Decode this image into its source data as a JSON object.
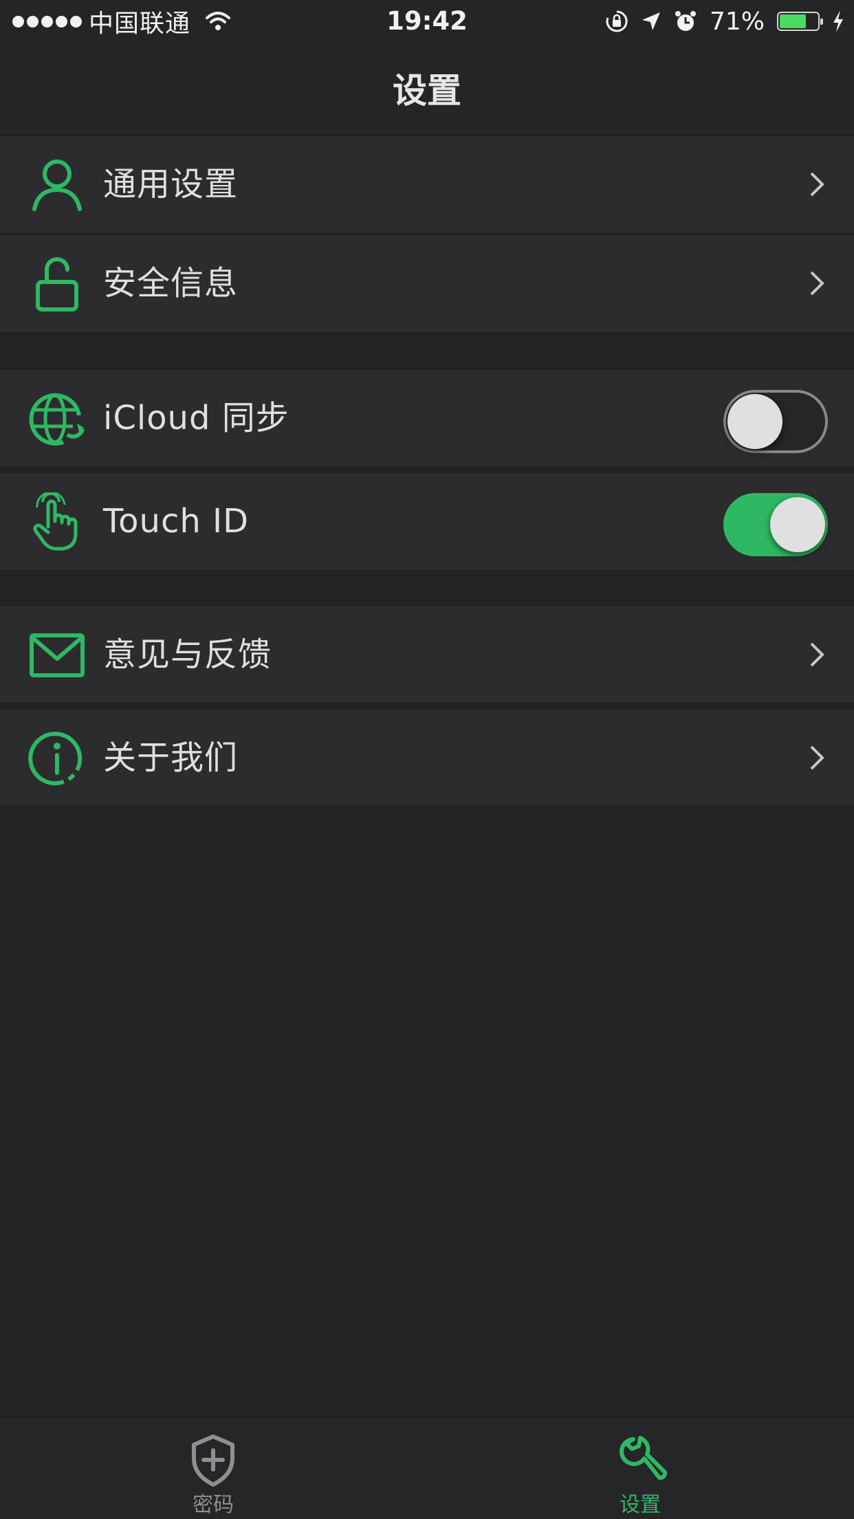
{
  "status_bar": {
    "carrier": "中国联通",
    "time": "19:42",
    "battery_percent": "71%",
    "battery_level": 0.71,
    "icons": [
      "signal-dots",
      "wifi-icon",
      "rotation-lock-icon",
      "location-arrow-icon",
      "alarm-icon",
      "battery-icon",
      "charging-bolt-icon"
    ]
  },
  "nav": {
    "title": "设置"
  },
  "settings": {
    "general": {
      "label": "通用设置",
      "icon": "person-icon"
    },
    "security": {
      "label": "安全信息",
      "icon": "unlock-icon"
    },
    "icloud_sync": {
      "label": "iCloud 同步",
      "icon": "globe-sync-icon",
      "enabled": false
    },
    "touch_id": {
      "label": "Touch ID",
      "icon": "fingerprint-hand-icon",
      "enabled": true
    },
    "feedback": {
      "label": "意见与反馈",
      "icon": "mail-icon"
    },
    "about": {
      "label": "关于我们",
      "icon": "info-icon"
    }
  },
  "tab_bar": {
    "tabs": [
      {
        "label": "密码",
        "icon": "shield-plus-icon",
        "active": false
      },
      {
        "label": "设置",
        "icon": "wrench-icon",
        "active": true
      }
    ]
  },
  "colors": {
    "accent": "#2fb864",
    "background": "#222224",
    "row_background": "#2c2c2e",
    "inactive_tab": "#8e8e93"
  }
}
